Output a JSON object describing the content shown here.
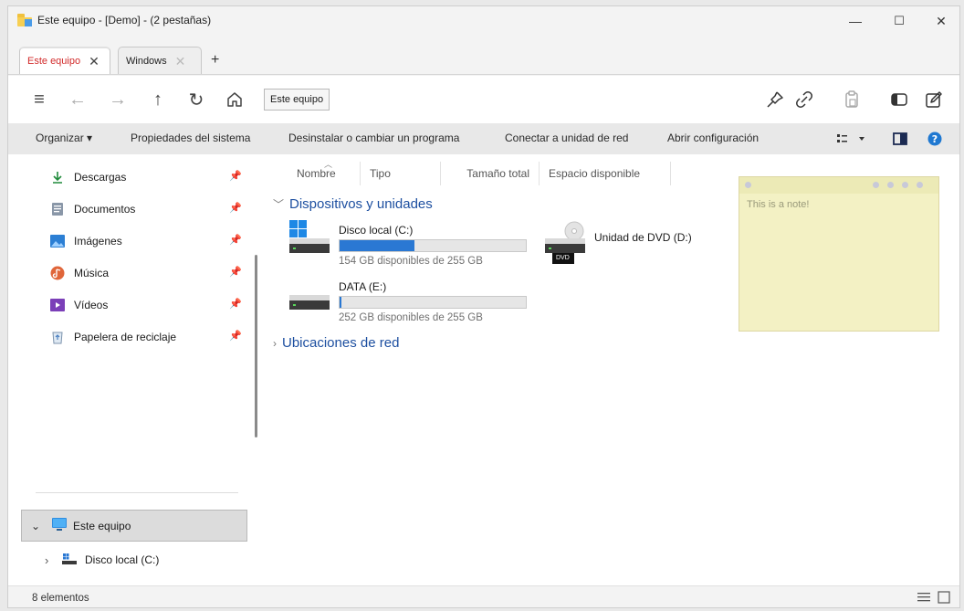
{
  "window": {
    "title": "Este equipo - [Demo] - (2 pestañas)",
    "minimize": "—",
    "maximize": "☐",
    "close": "✕"
  },
  "tabs": [
    {
      "label": "Este equipo",
      "close": "✕"
    },
    {
      "label": "Windows",
      "close": "✕"
    }
  ],
  "new_tab": "+",
  "nav": {
    "menu_icon": "≡",
    "back_icon": "←",
    "forward_icon": "→",
    "up_icon": "↑",
    "refresh_icon": "↻",
    "breadcrumb": "Este equipo"
  },
  "commands": {
    "organize": "Organizar ▾",
    "system_properties": "Propiedades del sistema",
    "uninstall": "Desinstalar o cambiar un programa",
    "map_drive": "Conectar a unidad de red",
    "open_settings": "Abrir configuración"
  },
  "sidebar": {
    "quick_access": [
      {
        "label": "Descargas",
        "icon": "download-icon"
      },
      {
        "label": "Documentos",
        "icon": "document-icon"
      },
      {
        "label": "Imágenes",
        "icon": "image-icon"
      },
      {
        "label": "Música",
        "icon": "music-icon"
      },
      {
        "label": "Vídeos",
        "icon": "video-icon"
      },
      {
        "label": "Papelera de reciclaje",
        "icon": "recycle-bin-icon"
      }
    ],
    "tree": [
      {
        "label": "Este equipo",
        "expander": "⌄"
      },
      {
        "label": "Disco local (C:)",
        "expander": "›"
      }
    ]
  },
  "columns": [
    "Nombre",
    "Tipo",
    "Tamaño total",
    "Espacio disponible"
  ],
  "groups": {
    "devices": "Dispositivos y unidades",
    "network": "Ubicaciones de red"
  },
  "drives": [
    {
      "name": "Disco local (C:)",
      "free_text": "154 GB disponibles de 255 GB",
      "used_fraction": 0.4
    },
    {
      "name": "DATA (E:)",
      "free_text": "252 GB disponibles de 255 GB",
      "used_fraction": 0.01
    },
    {
      "name": "Unidad de DVD (D:)",
      "badge": "DVD"
    }
  ],
  "note": {
    "text": "This is a note!"
  },
  "status": {
    "count": "8 elementos"
  },
  "colors": {
    "accent": "#2a78d3",
    "active_tab_text": "#d22b2b",
    "group_title": "#1d4fa0",
    "note_bg": "#f3f1c4"
  }
}
